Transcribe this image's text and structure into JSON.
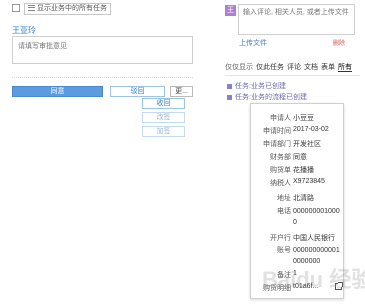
{
  "task_filter": {
    "label": "显示业务中的所有任务"
  },
  "approver": {
    "name": "王亚玲",
    "placeholder": "请填写审批意见"
  },
  "actions": {
    "approve": "同意",
    "reject": "驳回",
    "more": "更...",
    "menu": [
      {
        "label": "收回",
        "disabled": false
      },
      {
        "label": "改签",
        "disabled": true
      },
      {
        "label": "加签",
        "disabled": true
      }
    ]
  },
  "comment": {
    "avatar_letter": "王",
    "placeholder": "输入评论, 相关人员, 或者上传文件",
    "upload_label": "上传文件",
    "delete_label": "删除"
  },
  "filter": {
    "prefix": "仅仅显示",
    "options": [
      {
        "label": "仅此任务",
        "active": false
      },
      {
        "label": "评论",
        "active": false
      },
      {
        "label": "文档",
        "active": false
      },
      {
        "label": "表单",
        "active": false
      },
      {
        "label": "所有",
        "active": true
      }
    ]
  },
  "activity_log": [
    "任务:业务已创建",
    "任务:业务的流程已创建"
  ],
  "detail_card": {
    "rows": [
      {
        "label": "申请人",
        "value": "小豆豆"
      },
      {
        "label": "申请时间",
        "value": "2017-03-02"
      },
      {
        "label": "申请部门",
        "value": "开发社区"
      },
      {
        "label": "财务部",
        "value": "同意"
      },
      {
        "label": "购货单",
        "value": "花播播"
      },
      {
        "label": "纳税人",
        "value": "X9723845"
      },
      {
        "label": "地址",
        "value": "北清路"
      },
      {
        "label": "电话",
        "value": "0000000010000"
      },
      {
        "label": "开户行",
        "value": "中国人民银行"
      },
      {
        "label": "账号",
        "value": "0000000000010000000"
      },
      {
        "label": "备注",
        "value": "1"
      },
      {
        "label": "购货明细",
        "value": "t01a6f..."
      }
    ]
  },
  "watermark": "Baidu 经验"
}
